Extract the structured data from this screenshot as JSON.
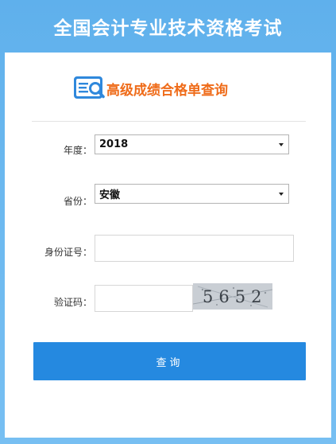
{
  "header": {
    "title": "全国会计专业技术资格考试"
  },
  "section": {
    "heading": "高级成绩合格单查询",
    "icon": "search-document-icon",
    "accent_color": "#ef6c1a"
  },
  "form": {
    "year": {
      "label": "年度：",
      "value": "2018"
    },
    "province": {
      "label": "省份：",
      "value": "安徽"
    },
    "id_number": {
      "label": "身份证号：",
      "value": "",
      "placeholder": ""
    },
    "captcha": {
      "label": "验证码：",
      "value": "",
      "placeholder": "",
      "image_text": "5652"
    },
    "submit": {
      "label": "查询",
      "color": "#2589e0"
    }
  }
}
